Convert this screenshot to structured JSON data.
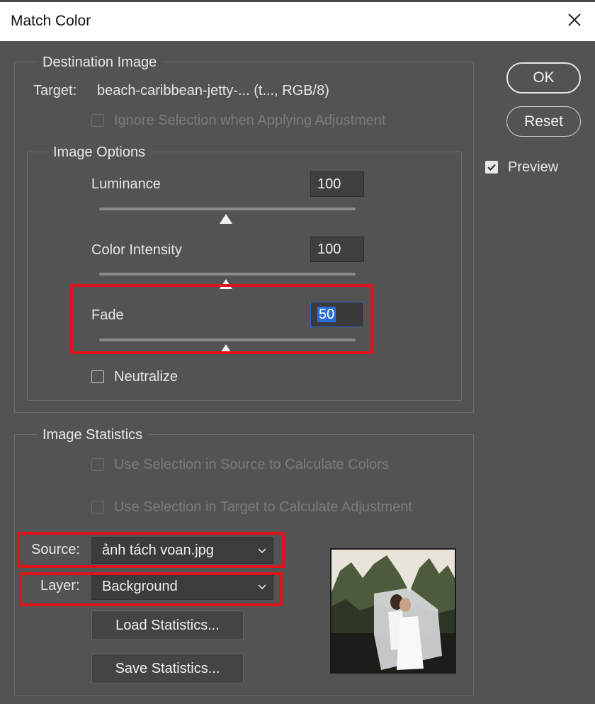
{
  "dialog": {
    "title": "Match Color"
  },
  "buttons": {
    "ok": "OK",
    "reset": "Reset",
    "load_statistics": "Load Statistics...",
    "save_statistics": "Save Statistics..."
  },
  "preview": {
    "label": "Preview",
    "checked": true
  },
  "destination": {
    "legend": "Destination Image",
    "target_label": "Target:",
    "target_value": "beach-caribbean-jetty-... (t..., RGB/8)",
    "ignore_selection_label": "Ignore Selection when Applying Adjustment"
  },
  "image_options": {
    "legend": "Image Options",
    "luminance": {
      "label": "Luminance",
      "value": "100",
      "slider_fraction": 0.5
    },
    "color_intensity": {
      "label": "Color Intensity",
      "value": "100",
      "slider_fraction": 0.5
    },
    "fade": {
      "label": "Fade",
      "value": "50",
      "slider_fraction": 0.5
    },
    "neutralize_label": "Neutralize"
  },
  "statistics": {
    "legend": "Image Statistics",
    "use_source_selection_label": "Use Selection in Source to Calculate Colors",
    "use_target_selection_label": "Use Selection in Target to Calculate Adjustment",
    "source_label": "Source:",
    "source_value": "ảnh tách voan.jpg",
    "layer_label": "Layer:",
    "layer_value": "Background"
  },
  "colors": {
    "background": "#535353",
    "highlight": "#e0131a",
    "selection": "#2b6fd6"
  }
}
